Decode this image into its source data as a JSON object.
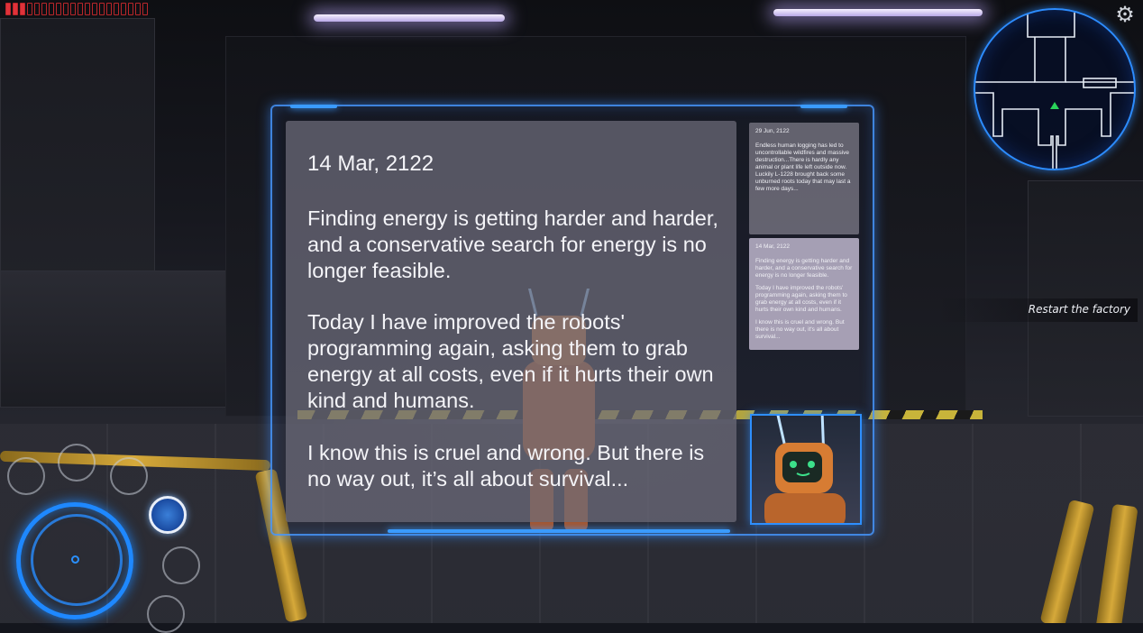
{
  "hud": {
    "energy_total": 20,
    "energy_filled": 3,
    "energy_color": "#e0323a",
    "settings_icon": "gear-icon"
  },
  "journal": {
    "date": "14 Mar, 2122",
    "paragraphs": [
      "Finding energy is getting harder and harder, and a conservative search for energy is no longer feasible.",
      "Today I have improved the robots' programming again, asking them to grab energy at all costs, even if it hurts their own kind and humans.",
      "I know this is cruel and wrong. But there is no way out, it’s all about survival..."
    ],
    "entries": [
      {
        "date": "29 Jun, 2122",
        "text": "Endless human logging has led to uncontrollable wildfires and massive          destruction...There is hardly any animal or plant life left outside now.\nLuckily L-1228 brought back some unburned roots today that may last a few more days..."
      },
      {
        "date": "14 Mar, 2122",
        "paragraphs": [
          "Finding energy is getting harder and harder, and a conservative search for energy is no longer feasible.",
          "Today I have improved the robots' programming again, asking them to grab energy at all costs, even if it hurts their own kind and humans.",
          "I know this is cruel and wrong. But there is no way out, it's all about survival..."
        ]
      }
    ]
  },
  "objective": {
    "label": "Restart the factory"
  },
  "colors": {
    "hud_blue": "#1e88ff",
    "page_bg": "#6e6c7a",
    "hazard_yellow": "#c8b43a"
  }
}
